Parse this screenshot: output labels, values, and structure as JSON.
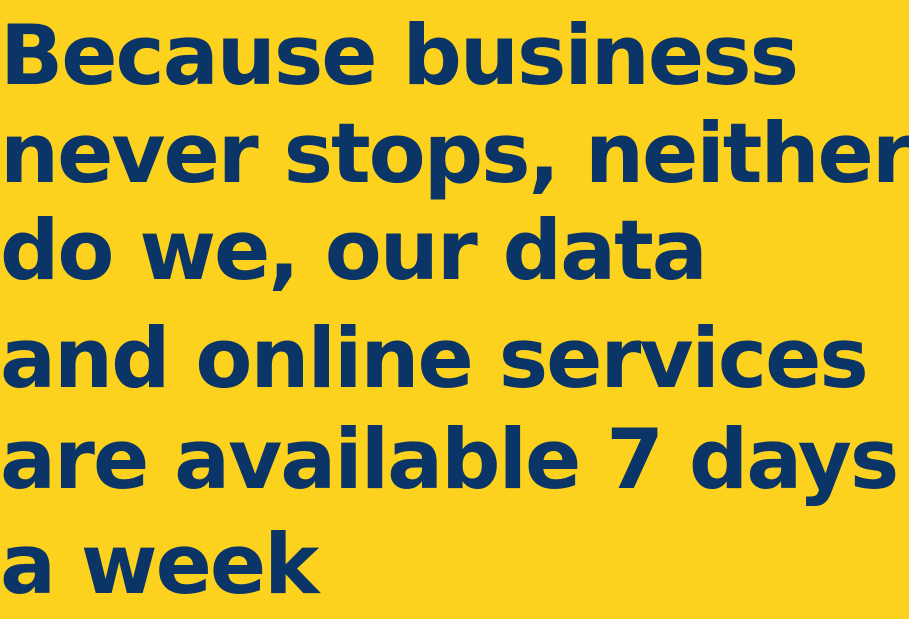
{
  "colors": {
    "background": "#FDD21E",
    "text": "#0B3566"
  },
  "headline": {
    "lines": [
      "Because business",
      "never stops, neither",
      "do we, our data",
      "and online services",
      "are available 7 days",
      "a week"
    ]
  }
}
